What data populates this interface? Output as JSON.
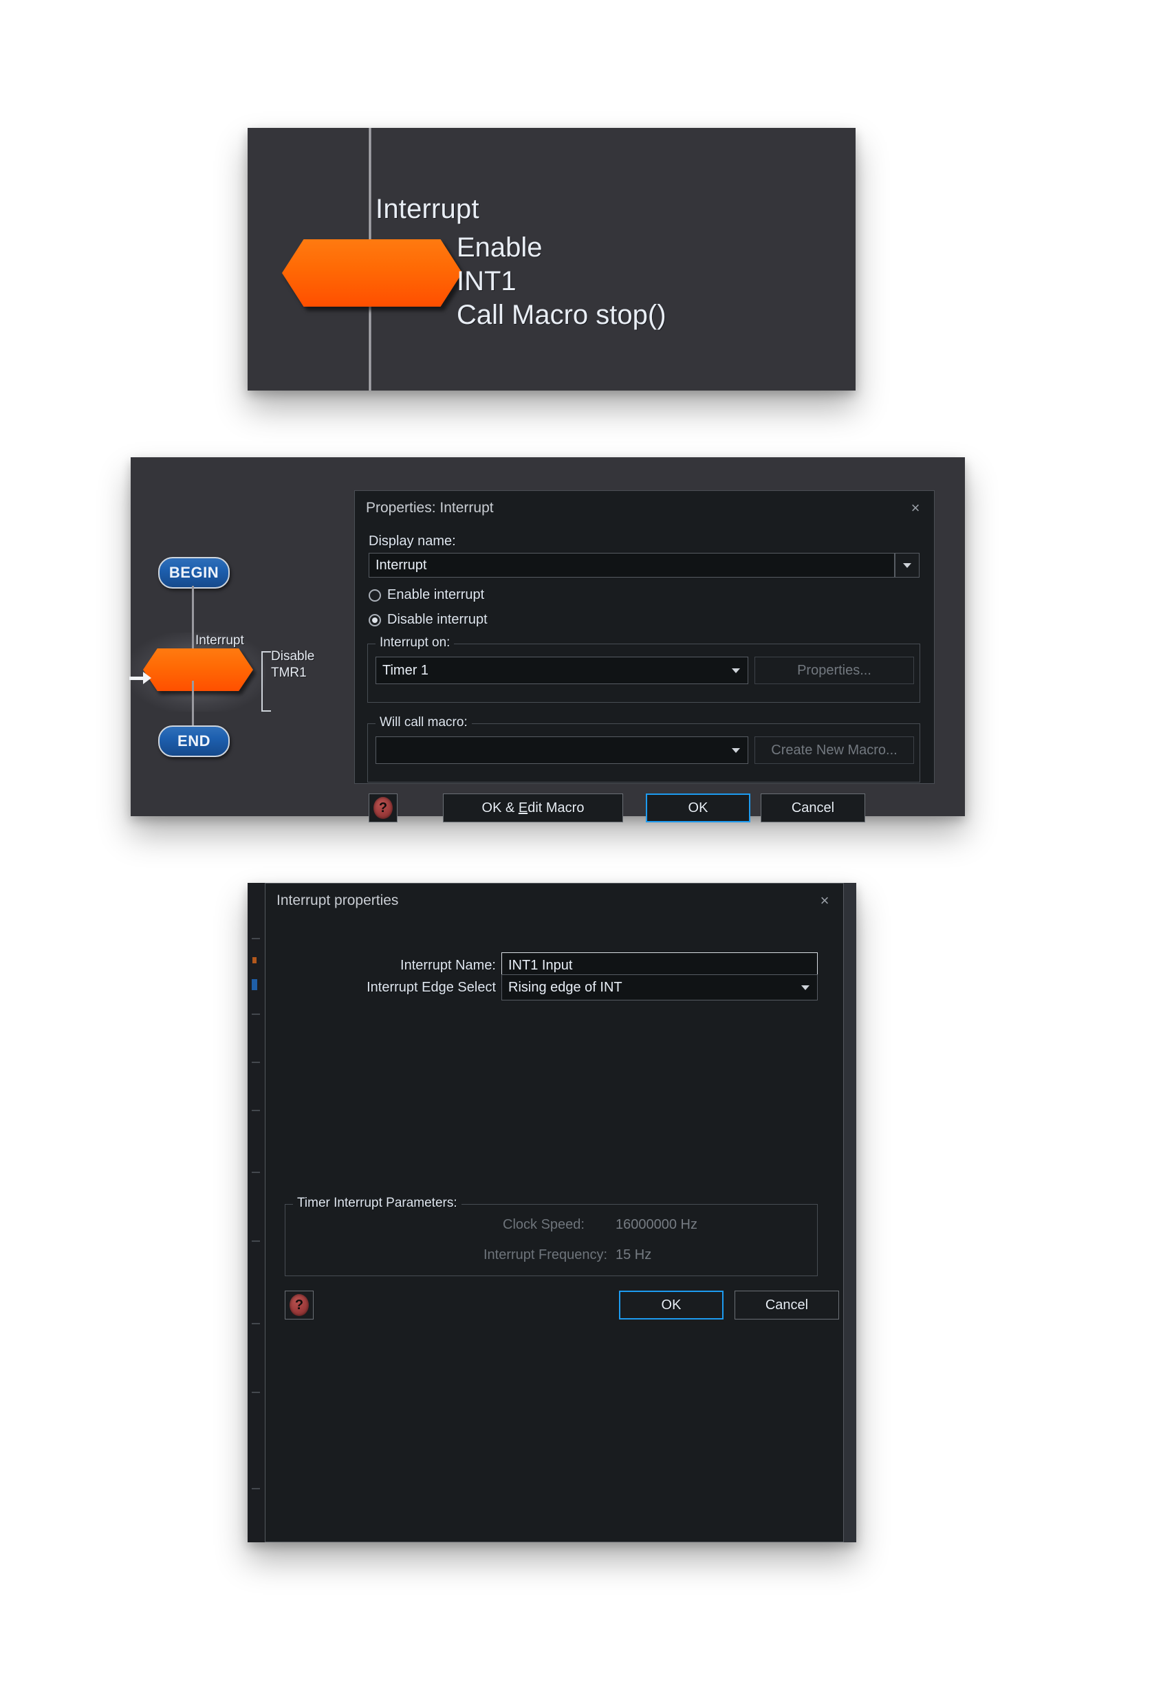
{
  "panel1": {
    "node_label": "Interrupt",
    "description_lines": [
      "Enable",
      "INT1",
      "Call Macro stop()"
    ],
    "node_color": "#ff5a02",
    "background": "#35353a"
  },
  "panel2": {
    "flowchart": {
      "begin_label": "BEGIN",
      "end_label": "END",
      "node_label": "Interrupt",
      "annotation_lines": [
        "Disable",
        "TMR1"
      ],
      "node_color": "#ff5a02",
      "pill_color": "#1d5fae"
    },
    "dialog": {
      "title": "Properties: Interrupt",
      "close_label": "×",
      "display_name_label": "Display name:",
      "display_name_value": "Interrupt",
      "radios": [
        {
          "label": "Enable interrupt",
          "selected": false
        },
        {
          "label": "Disable interrupt",
          "selected": true
        }
      ],
      "interrupt_on": {
        "legend": "Interrupt on:",
        "value": "Timer 1",
        "button_label": "Properties..."
      },
      "will_call_macro": {
        "legend": "Will call macro:",
        "value": "",
        "button_label": "Create New Macro..."
      },
      "help_glyph": "?",
      "buttons": {
        "ok_edit_macro": "OK & Edit Macro",
        "ok": "OK",
        "cancel": "Cancel"
      }
    }
  },
  "panel3": {
    "dialog": {
      "title": "Interrupt properties",
      "close_label": "×",
      "fields": [
        {
          "label": "Interrupt Name:",
          "value": "INT1 Input",
          "type": "text"
        },
        {
          "label": "Interrupt Edge Select",
          "value": "Rising edge of INT",
          "type": "combo"
        }
      ],
      "timer_group": {
        "legend": "Timer Interrupt Parameters:",
        "rows": [
          {
            "label": "Clock Speed:",
            "value": "16000000 Hz"
          },
          {
            "label": "Interrupt Frequency:",
            "value": "15 Hz"
          }
        ]
      },
      "help_glyph": "?",
      "buttons": {
        "ok": "OK",
        "cancel": "Cancel"
      }
    }
  },
  "colors": {
    "accent_blue": "#1d9bf0",
    "node_orange": "#ff5a02",
    "pill_blue": "#1d5fae",
    "dialog_bg": "#191c1f",
    "canvas_bg": "#35353a"
  }
}
